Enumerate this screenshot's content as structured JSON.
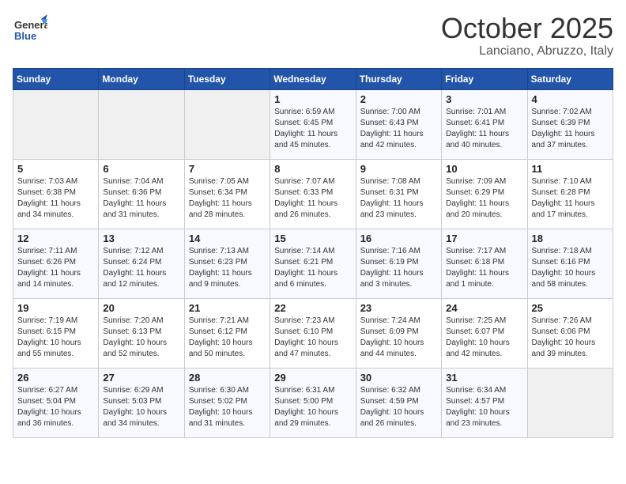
{
  "logo": {
    "general": "General",
    "blue": "Blue"
  },
  "header": {
    "month": "October 2025",
    "location": "Lanciano, Abruzzo, Italy"
  },
  "weekdays": [
    "Sunday",
    "Monday",
    "Tuesday",
    "Wednesday",
    "Thursday",
    "Friday",
    "Saturday"
  ],
  "weeks": [
    [
      {
        "day": "",
        "sunrise": "",
        "sunset": "",
        "daylight": ""
      },
      {
        "day": "",
        "sunrise": "",
        "sunset": "",
        "daylight": ""
      },
      {
        "day": "",
        "sunrise": "",
        "sunset": "",
        "daylight": ""
      },
      {
        "day": "1",
        "sunrise": "Sunrise: 6:59 AM",
        "sunset": "Sunset: 6:45 PM",
        "daylight": "Daylight: 11 hours and 45 minutes."
      },
      {
        "day": "2",
        "sunrise": "Sunrise: 7:00 AM",
        "sunset": "Sunset: 6:43 PM",
        "daylight": "Daylight: 11 hours and 42 minutes."
      },
      {
        "day": "3",
        "sunrise": "Sunrise: 7:01 AM",
        "sunset": "Sunset: 6:41 PM",
        "daylight": "Daylight: 11 hours and 40 minutes."
      },
      {
        "day": "4",
        "sunrise": "Sunrise: 7:02 AM",
        "sunset": "Sunset: 6:39 PM",
        "daylight": "Daylight: 11 hours and 37 minutes."
      }
    ],
    [
      {
        "day": "5",
        "sunrise": "Sunrise: 7:03 AM",
        "sunset": "Sunset: 6:38 PM",
        "daylight": "Daylight: 11 hours and 34 minutes."
      },
      {
        "day": "6",
        "sunrise": "Sunrise: 7:04 AM",
        "sunset": "Sunset: 6:36 PM",
        "daylight": "Daylight: 11 hours and 31 minutes."
      },
      {
        "day": "7",
        "sunrise": "Sunrise: 7:05 AM",
        "sunset": "Sunset: 6:34 PM",
        "daylight": "Daylight: 11 hours and 28 minutes."
      },
      {
        "day": "8",
        "sunrise": "Sunrise: 7:07 AM",
        "sunset": "Sunset: 6:33 PM",
        "daylight": "Daylight: 11 hours and 26 minutes."
      },
      {
        "day": "9",
        "sunrise": "Sunrise: 7:08 AM",
        "sunset": "Sunset: 6:31 PM",
        "daylight": "Daylight: 11 hours and 23 minutes."
      },
      {
        "day": "10",
        "sunrise": "Sunrise: 7:09 AM",
        "sunset": "Sunset: 6:29 PM",
        "daylight": "Daylight: 11 hours and 20 minutes."
      },
      {
        "day": "11",
        "sunrise": "Sunrise: 7:10 AM",
        "sunset": "Sunset: 6:28 PM",
        "daylight": "Daylight: 11 hours and 17 minutes."
      }
    ],
    [
      {
        "day": "12",
        "sunrise": "Sunrise: 7:11 AM",
        "sunset": "Sunset: 6:26 PM",
        "daylight": "Daylight: 11 hours and 14 minutes."
      },
      {
        "day": "13",
        "sunrise": "Sunrise: 7:12 AM",
        "sunset": "Sunset: 6:24 PM",
        "daylight": "Daylight: 11 hours and 12 minutes."
      },
      {
        "day": "14",
        "sunrise": "Sunrise: 7:13 AM",
        "sunset": "Sunset: 6:23 PM",
        "daylight": "Daylight: 11 hours and 9 minutes."
      },
      {
        "day": "15",
        "sunrise": "Sunrise: 7:14 AM",
        "sunset": "Sunset: 6:21 PM",
        "daylight": "Daylight: 11 hours and 6 minutes."
      },
      {
        "day": "16",
        "sunrise": "Sunrise: 7:16 AM",
        "sunset": "Sunset: 6:19 PM",
        "daylight": "Daylight: 11 hours and 3 minutes."
      },
      {
        "day": "17",
        "sunrise": "Sunrise: 7:17 AM",
        "sunset": "Sunset: 6:18 PM",
        "daylight": "Daylight: 11 hours and 1 minute."
      },
      {
        "day": "18",
        "sunrise": "Sunrise: 7:18 AM",
        "sunset": "Sunset: 6:16 PM",
        "daylight": "Daylight: 10 hours and 58 minutes."
      }
    ],
    [
      {
        "day": "19",
        "sunrise": "Sunrise: 7:19 AM",
        "sunset": "Sunset: 6:15 PM",
        "daylight": "Daylight: 10 hours and 55 minutes."
      },
      {
        "day": "20",
        "sunrise": "Sunrise: 7:20 AM",
        "sunset": "Sunset: 6:13 PM",
        "daylight": "Daylight: 10 hours and 52 minutes."
      },
      {
        "day": "21",
        "sunrise": "Sunrise: 7:21 AM",
        "sunset": "Sunset: 6:12 PM",
        "daylight": "Daylight: 10 hours and 50 minutes."
      },
      {
        "day": "22",
        "sunrise": "Sunrise: 7:23 AM",
        "sunset": "Sunset: 6:10 PM",
        "daylight": "Daylight: 10 hours and 47 minutes."
      },
      {
        "day": "23",
        "sunrise": "Sunrise: 7:24 AM",
        "sunset": "Sunset: 6:09 PM",
        "daylight": "Daylight: 10 hours and 44 minutes."
      },
      {
        "day": "24",
        "sunrise": "Sunrise: 7:25 AM",
        "sunset": "Sunset: 6:07 PM",
        "daylight": "Daylight: 10 hours and 42 minutes."
      },
      {
        "day": "25",
        "sunrise": "Sunrise: 7:26 AM",
        "sunset": "Sunset: 6:06 PM",
        "daylight": "Daylight: 10 hours and 39 minutes."
      }
    ],
    [
      {
        "day": "26",
        "sunrise": "Sunrise: 6:27 AM",
        "sunset": "Sunset: 5:04 PM",
        "daylight": "Daylight: 10 hours and 36 minutes."
      },
      {
        "day": "27",
        "sunrise": "Sunrise: 6:29 AM",
        "sunset": "Sunset: 5:03 PM",
        "daylight": "Daylight: 10 hours and 34 minutes."
      },
      {
        "day": "28",
        "sunrise": "Sunrise: 6:30 AM",
        "sunset": "Sunset: 5:02 PM",
        "daylight": "Daylight: 10 hours and 31 minutes."
      },
      {
        "day": "29",
        "sunrise": "Sunrise: 6:31 AM",
        "sunset": "Sunset: 5:00 PM",
        "daylight": "Daylight: 10 hours and 29 minutes."
      },
      {
        "day": "30",
        "sunrise": "Sunrise: 6:32 AM",
        "sunset": "Sunset: 4:59 PM",
        "daylight": "Daylight: 10 hours and 26 minutes."
      },
      {
        "day": "31",
        "sunrise": "Sunrise: 6:34 AM",
        "sunset": "Sunset: 4:57 PM",
        "daylight": "Daylight: 10 hours and 23 minutes."
      },
      {
        "day": "",
        "sunrise": "",
        "sunset": "",
        "daylight": ""
      }
    ]
  ]
}
